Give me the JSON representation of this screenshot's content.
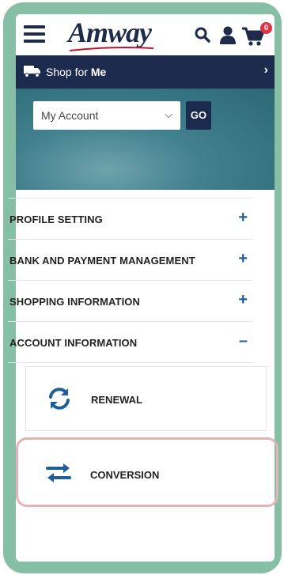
{
  "header": {
    "logo": "Amway",
    "cart_count": "0"
  },
  "shop_bar": {
    "prefix": "Shop for",
    "suffix": "Me"
  },
  "account_selector": {
    "selected": "My Account",
    "go_label": "GO"
  },
  "menu": [
    {
      "label": "PROFILE SETTING",
      "state": "+"
    },
    {
      "label": "BANK AND PAYMENT MANAGEMENT",
      "state": "+"
    },
    {
      "label": "SHOPPING INFORMATION",
      "state": "+"
    },
    {
      "label": "ACCOUNT INFORMATION",
      "state": "–"
    }
  ],
  "submenu": [
    {
      "label": "RENEWAL",
      "icon": "renewal-sync-icon"
    },
    {
      "label": "CONVERSION",
      "icon": "conversion-swap-icon"
    }
  ],
  "colors": {
    "brand_navy": "#1c2a4e",
    "accent_blue": "#1c5f99",
    "frame_green": "#86bfa6",
    "highlight": "#e3b3b5",
    "badge_red": "#e03140"
  }
}
